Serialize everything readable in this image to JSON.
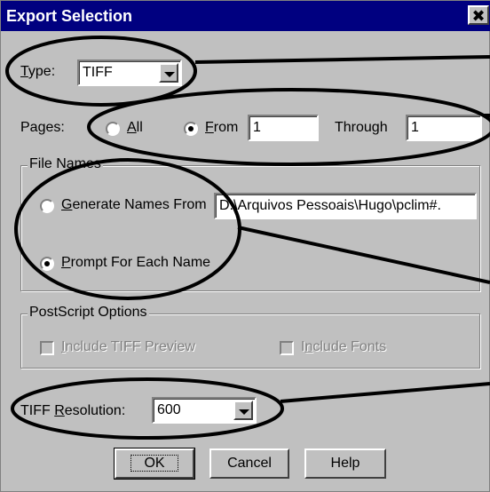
{
  "dialog": {
    "title": "Export Selection",
    "close_glyph": "✖"
  },
  "type": {
    "label_first": "T",
    "label_rest": "ype:",
    "value": "TIFF"
  },
  "pages": {
    "label": "Pages:",
    "all_first": "A",
    "all_rest": "ll",
    "all_checked": false,
    "from_first": "F",
    "from_rest": "rom",
    "from_checked": true,
    "from_value": "1",
    "through_label": "Through",
    "through_value": "1"
  },
  "file_names": {
    "group_label": "File Names",
    "generate_first": "G",
    "generate_rest": "enerate Names From",
    "generate_checked": false,
    "path_value": "D:\\Arquivos Pessoais\\Hugo\\pclim#.",
    "prompt_first": "P",
    "prompt_rest": "rompt For Each Name",
    "prompt_checked": true
  },
  "postscript": {
    "group_label": "PostScript Options",
    "tiff_preview_first": "I",
    "tiff_preview_rest": "nclude TIFF Preview",
    "fonts_pre": "I",
    "fonts_first": "n",
    "fonts_rest": "clude Fonts"
  },
  "resolution": {
    "label_pre": "TIFF ",
    "label_first": "R",
    "label_rest": "esolution:",
    "value": "600"
  },
  "buttons": {
    "ok": "OK",
    "cancel": "Cancel",
    "help": "Help"
  },
  "colors": {
    "titlebar": "#000080",
    "face": "#c0c0c0",
    "annotation": "#000000"
  }
}
